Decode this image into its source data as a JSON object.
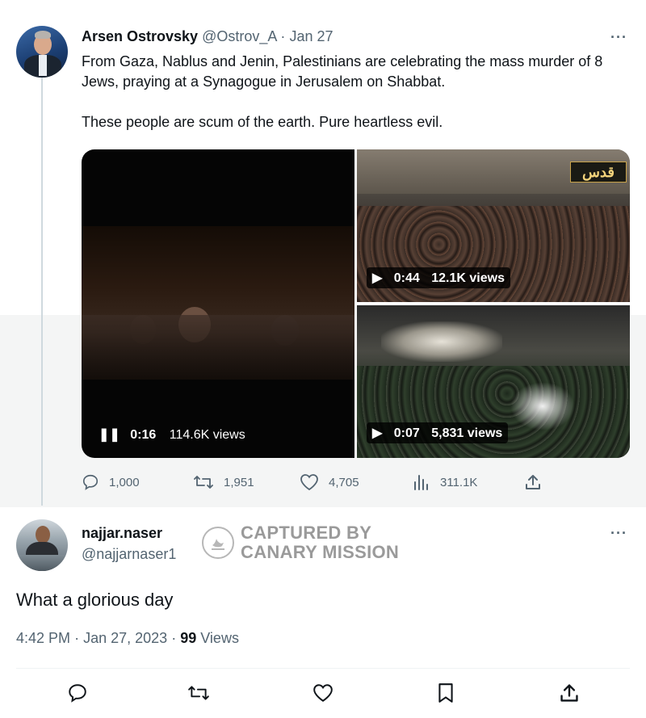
{
  "tweet": {
    "author_name": "Arsen Ostrovsky",
    "handle": "@Ostrov_A",
    "separator": "·",
    "date": "Jan 27",
    "text_line1": "From Gaza, Nablus and Jenin, Palestinians are celebrating the mass murder of 8 Jews, praying at a Synagogue in Jerusalem on Shabbat.",
    "text_line2": "These people are scum of the earth. Pure heartless evil.",
    "more_label": "···",
    "videos": [
      {
        "control": "❚❚",
        "duration": "0:16",
        "views": "114.6K views"
      },
      {
        "control": "▶",
        "duration": "0:44",
        "views": "12.1K views"
      },
      {
        "control": "▶",
        "duration": "0:07",
        "views": "5,831 views"
      }
    ],
    "channel_logo": "قدس",
    "stats": {
      "replies": "1,000",
      "retweets": "1,951",
      "likes": "4,705",
      "views": "311.1K"
    }
  },
  "reply": {
    "author_name": "najjar.naser",
    "handle": "@najjarnaser1",
    "more_label": "···",
    "text": "What a glorious day",
    "time": "4:42 PM",
    "separator": "·",
    "date": "Jan 27, 2023",
    "separator2": "·",
    "view_count": "99",
    "views_label": "Views"
  },
  "watermark": {
    "line1": "CAPTURED BY",
    "line2": "CANARY MISSION"
  },
  "colors": {
    "muted": "#536471",
    "text": "#0f1419",
    "band": "#f4f5f5",
    "thread_line": "#cfd9de"
  },
  "icons": [
    "reply-icon",
    "retweet-icon",
    "like-icon",
    "views-icon",
    "share-icon",
    "bookmark-icon",
    "more-icon",
    "canary-mission-logo"
  ]
}
